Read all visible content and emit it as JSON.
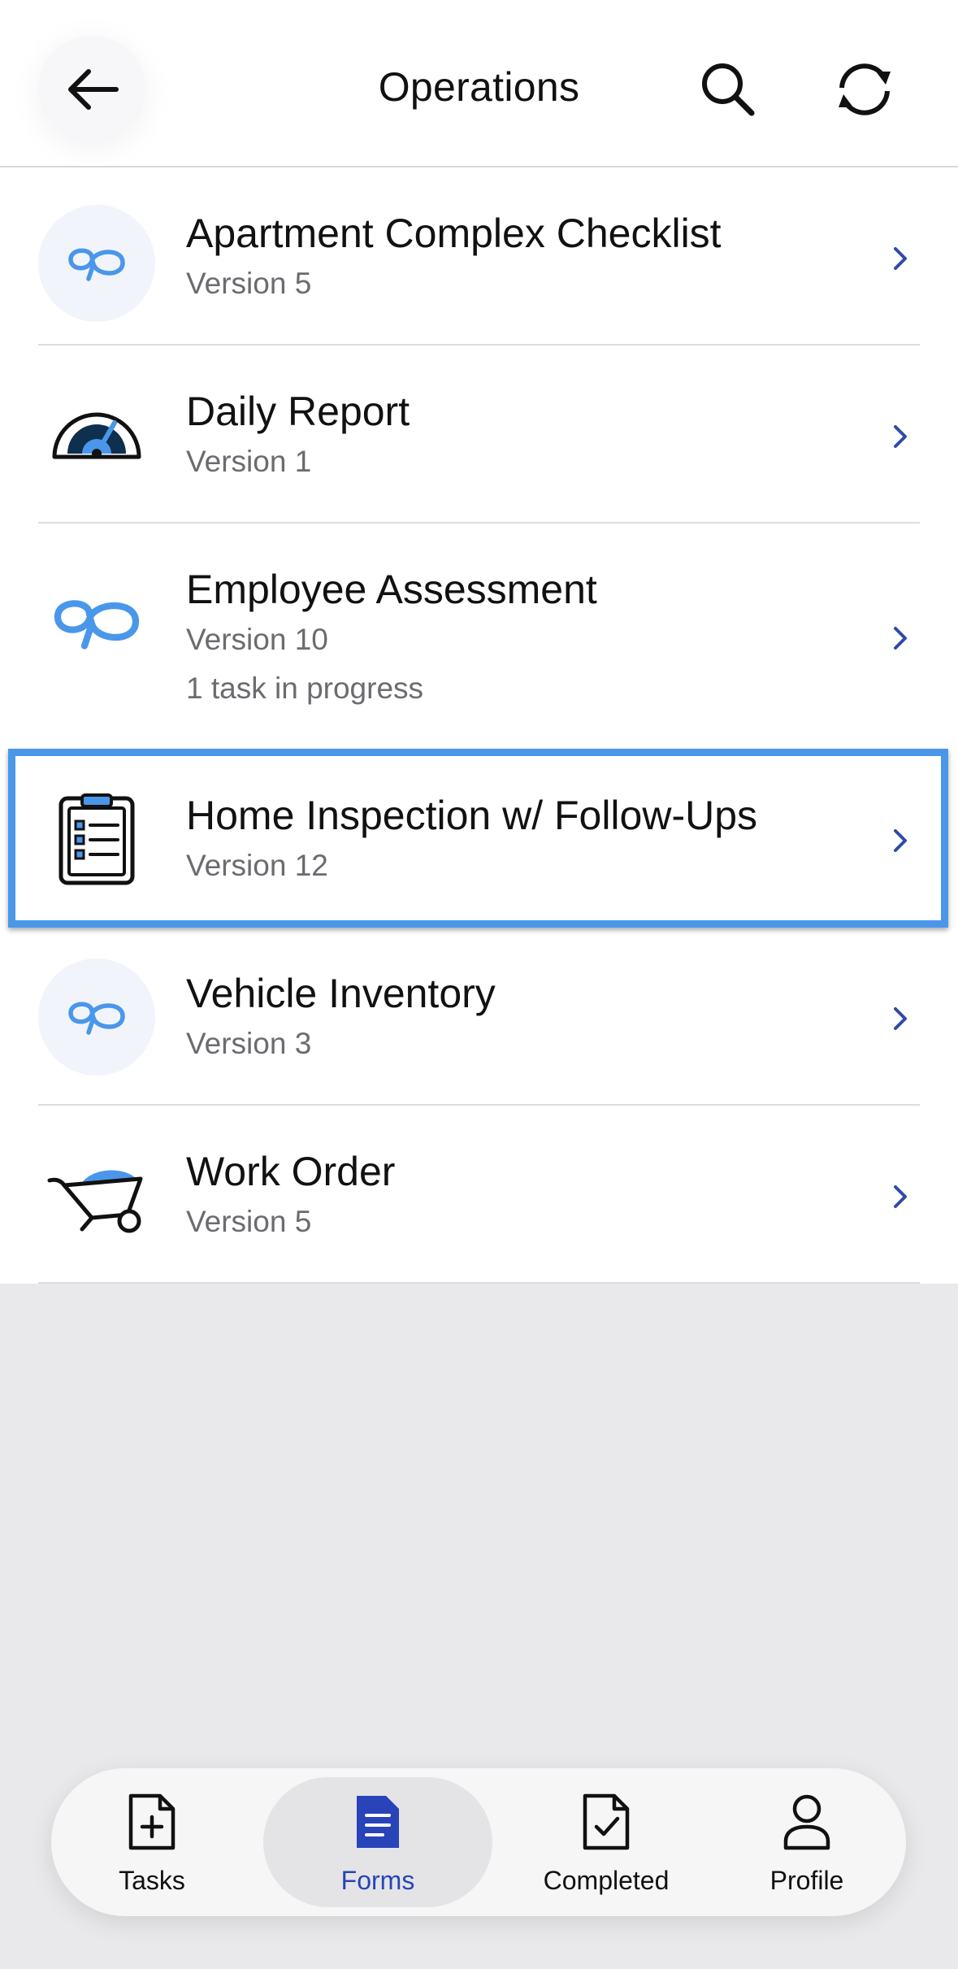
{
  "header": {
    "title": "Operations"
  },
  "forms": [
    {
      "title": "Apartment Complex Checklist",
      "version": "Version 5",
      "status": "",
      "icon": "logo-icon"
    },
    {
      "title": "Daily Report",
      "version": "Version 1",
      "status": "",
      "icon": "speedometer-icon"
    },
    {
      "title": "Employee Assessment",
      "version": "Version 10",
      "status": "1 task in progress",
      "icon": "logo-icon"
    },
    {
      "title": "Home Inspection w/ Follow-Ups",
      "version": "Version 12",
      "status": "",
      "icon": "clipboard-icon"
    },
    {
      "title": "Vehicle Inventory",
      "version": "Version 3",
      "status": "",
      "icon": "logo-icon"
    },
    {
      "title": "Work Order",
      "version": "Version 5",
      "status": "",
      "icon": "wheelbarrow-icon"
    }
  ],
  "tabbar": {
    "tabs": [
      {
        "label": "Tasks",
        "icon": "file-plus-icon"
      },
      {
        "label": "Forms",
        "icon": "document-icon",
        "active": true
      },
      {
        "label": "Completed",
        "icon": "file-check-icon"
      },
      {
        "label": "Profile",
        "icon": "person-icon"
      }
    ]
  },
  "colors": {
    "accent": "#2844b8",
    "logo_blue": "#4a97ea",
    "chevron": "#2f4aa8",
    "highlight_border": "#4a97ea"
  }
}
